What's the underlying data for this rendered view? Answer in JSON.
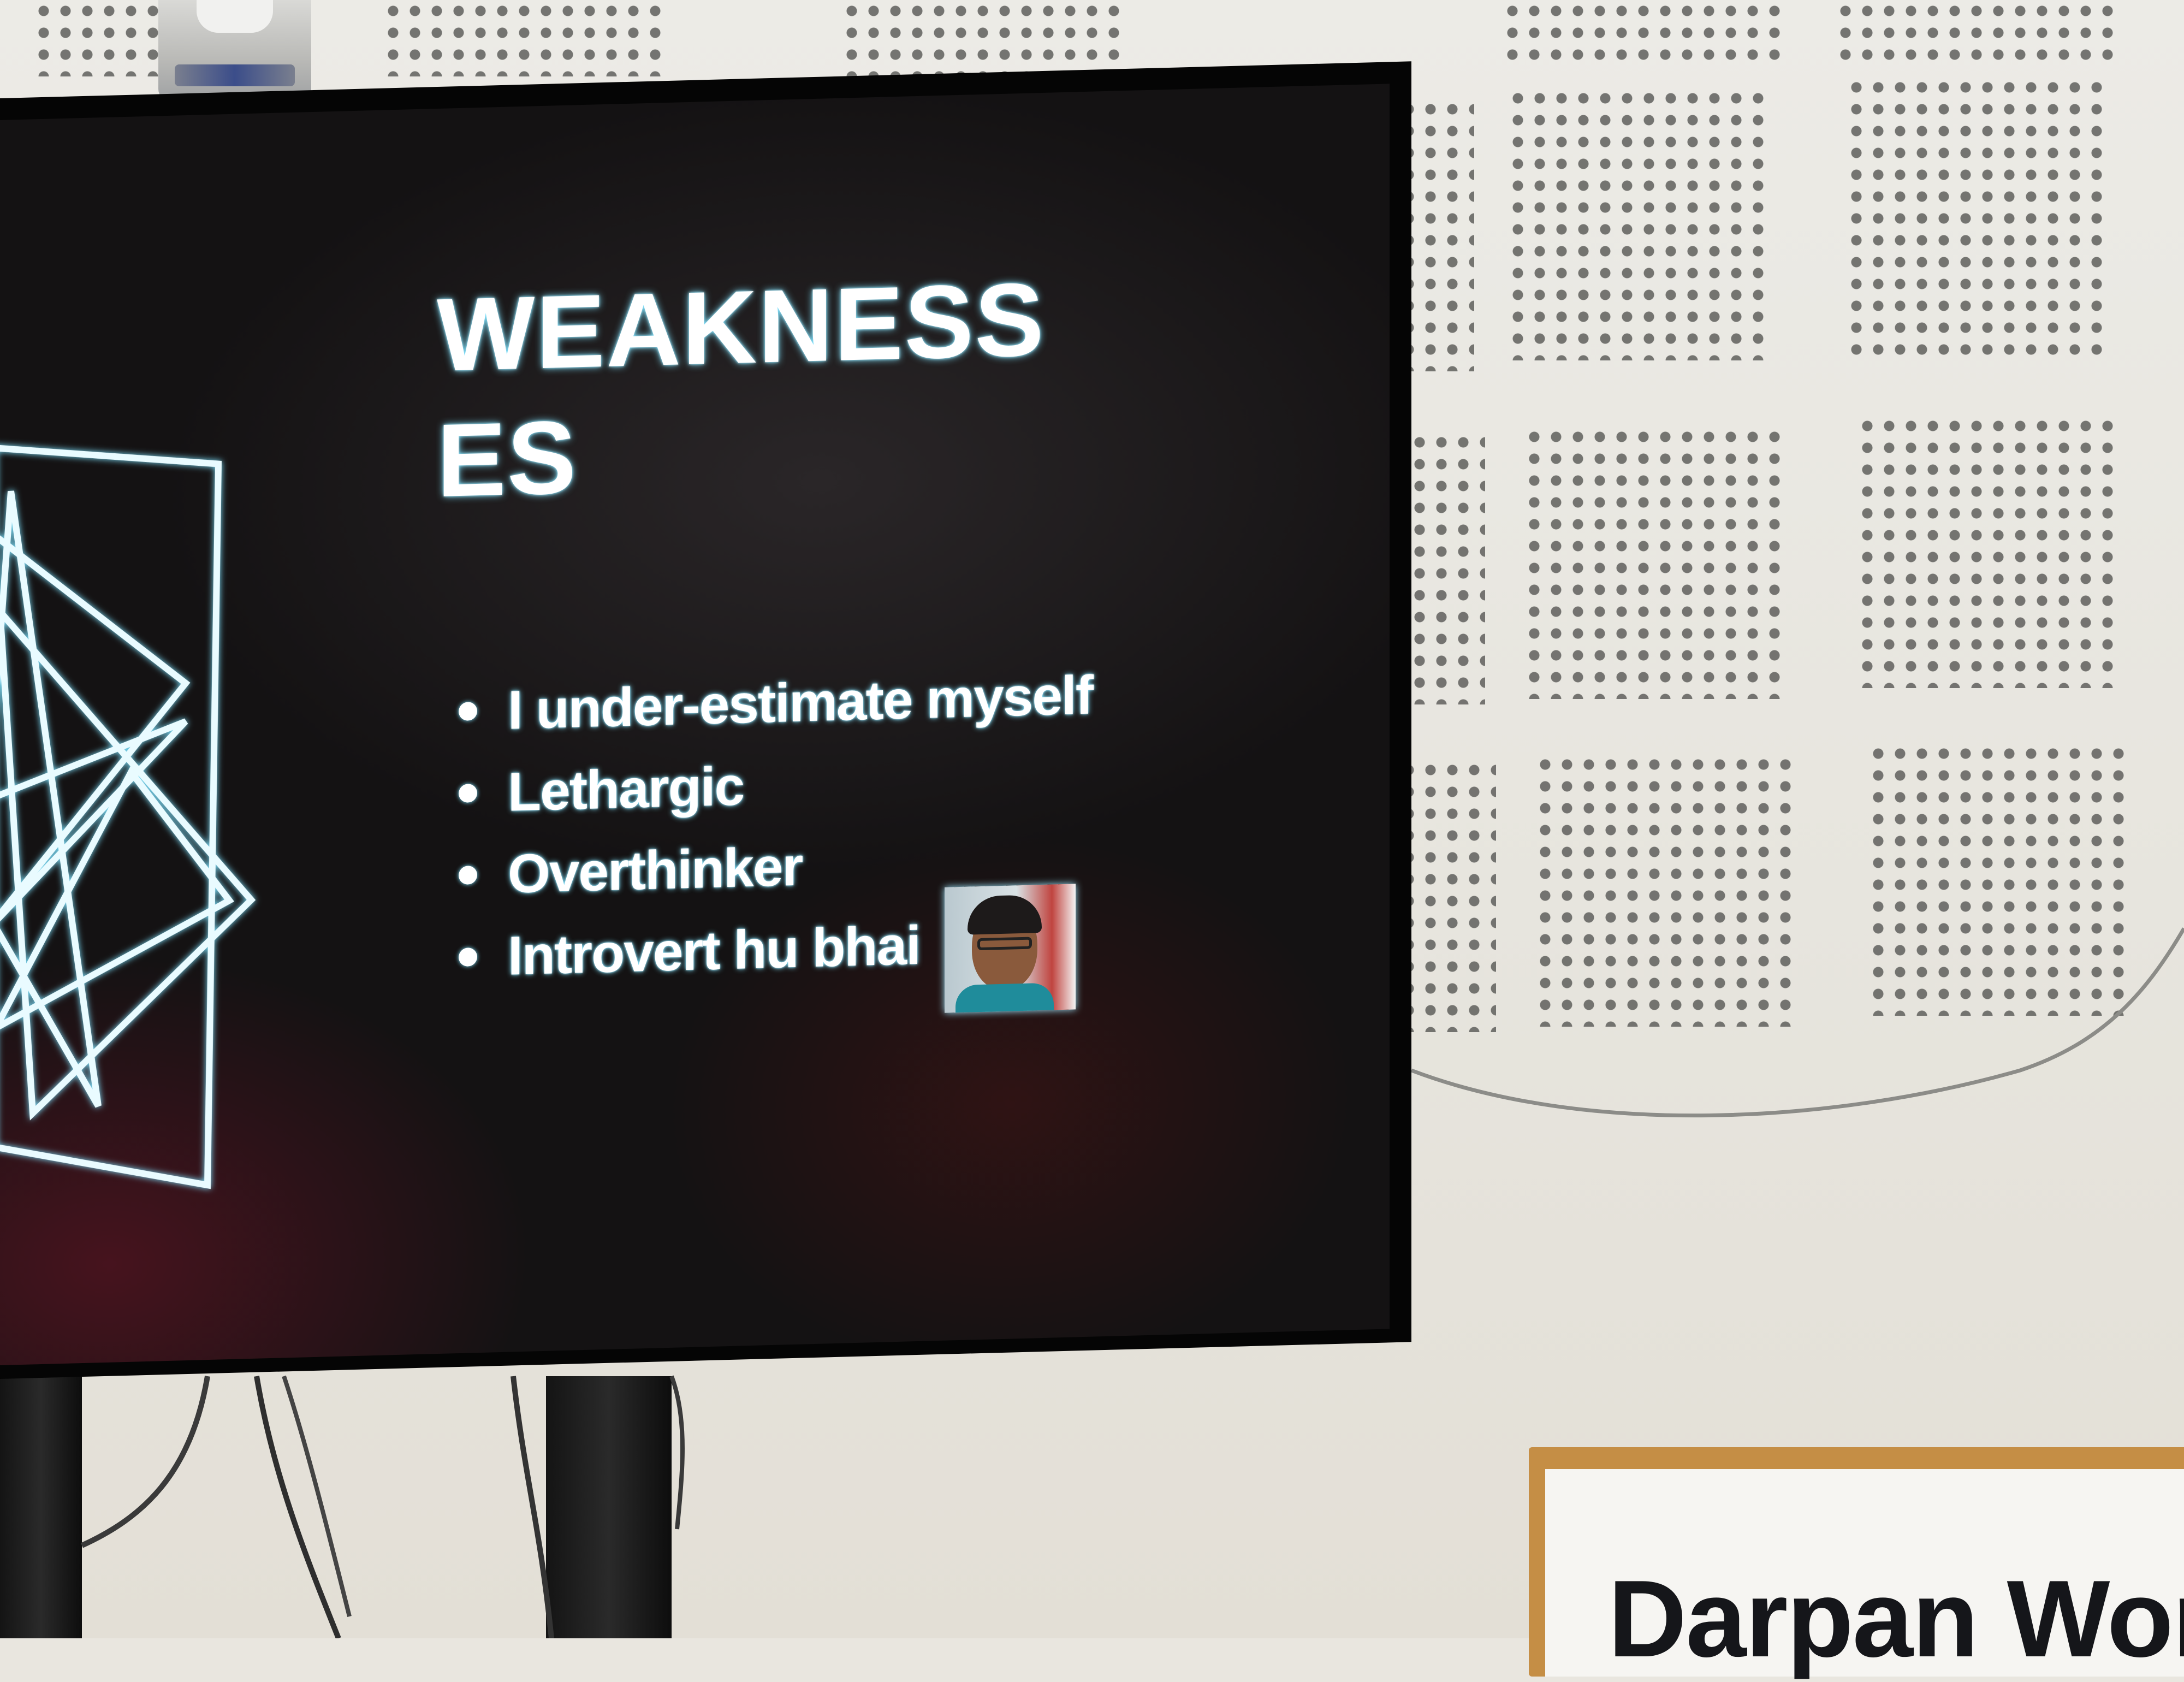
{
  "slide": {
    "title_line1": "WEAKNESS",
    "title_line2": "ES",
    "bullets": [
      "I under-estimate myself",
      "Lethargic",
      "Overthinker",
      "Introvert hu bhai"
    ]
  },
  "sign": {
    "text": "Darpan Work"
  },
  "colors": {
    "slide_background": "#141213",
    "text_glow": "#7fe3ff",
    "wall": "#ecebe6",
    "sign_frame": "#c58e45"
  },
  "icons": {
    "bullet": "bullet-dot-icon",
    "photo": "person-photo",
    "art": "line-art-shapes"
  }
}
